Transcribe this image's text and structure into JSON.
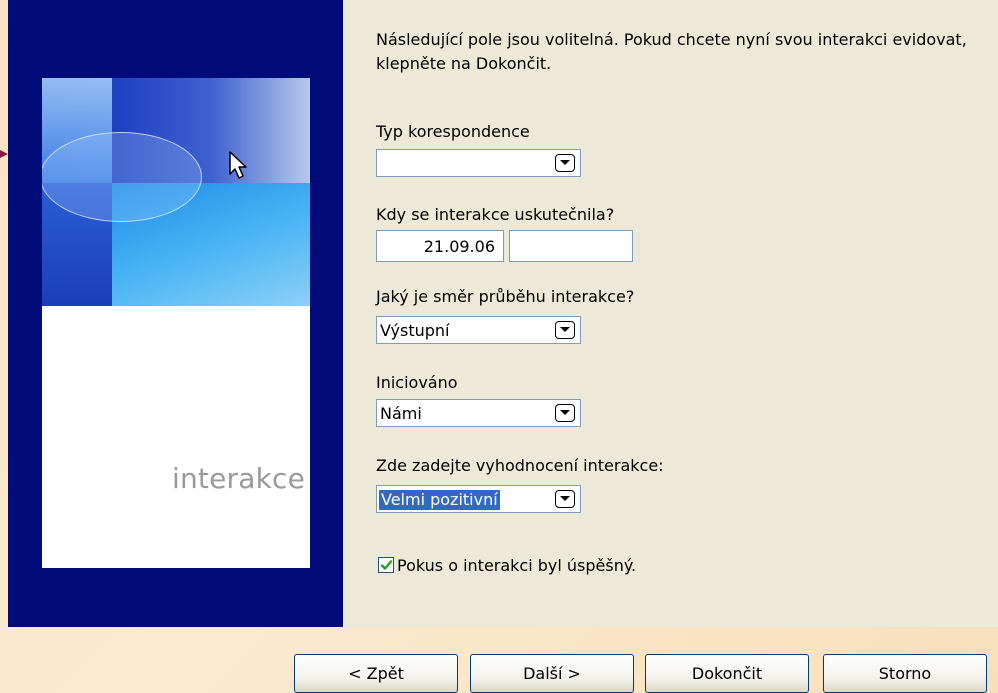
{
  "wizard": {
    "intro_text": "Následující pole jsou volitelná. Pokud chcete nyní svou interakci evidovat, klepněte na Dokončit.",
    "sidebar_watermark": "interakce"
  },
  "fields": {
    "correspondence_type": {
      "label": "Typ korespondence",
      "value": ""
    },
    "when": {
      "label": "Kdy se interakce uskutečnila?",
      "date_value": "21.09.06",
      "time_value": ""
    },
    "direction": {
      "label": "Jaký je směr průběhu interakce?",
      "value": "Výstupní"
    },
    "initiated": {
      "label": "Iniciováno",
      "value": "Námi"
    },
    "evaluation": {
      "label": "Zde zadejte vyhodnocení interakce:",
      "value": "Velmi pozitivní"
    },
    "success": {
      "label": "Pokus o interakci byl úspěšný.",
      "checked": true
    }
  },
  "buttons": {
    "back": "< Zpět",
    "next": "Další >",
    "finish": "Dokončit",
    "cancel": "Storno"
  },
  "icons": {
    "dropdown": "chevron-down-icon",
    "cursor": "mouse-cursor-icon",
    "check": "checkmark-icon"
  },
  "colors": {
    "sidebar": "#000b7a",
    "dialog": "#ece9d8",
    "selection": "#316ac5",
    "check": "#21a121"
  }
}
